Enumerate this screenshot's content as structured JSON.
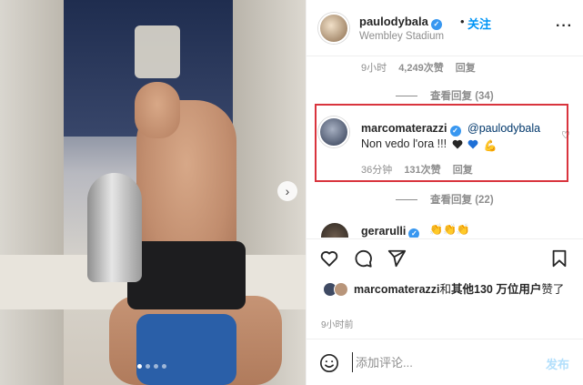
{
  "post": {
    "username": "paulodybala",
    "follow_label": "关注",
    "separator": "•",
    "location": "Wembley Stadium",
    "more_icon": "more-horizontal-icon"
  },
  "photo": {
    "description_icon": "post-photo",
    "next_icon": "chevron-right-icon",
    "carousel_dots": 4,
    "active_dot": 1
  },
  "previous_comment": {
    "time": "9小时",
    "likes": "4,249次赞",
    "reply_label": "回复"
  },
  "view_replies_1": "查看回复 (34)",
  "highlighted_comment": {
    "username": "marcomaterazzi",
    "mention": "@paulodybala",
    "text": "Non vedo l'ora !!!",
    "emoji": [
      "black-heart",
      "blue-heart",
      "flexed-biceps"
    ],
    "time": "36分钟",
    "likes": "131次赞",
    "reply_label": "回复",
    "highlight_color": "#d9343d"
  },
  "view_replies_2": "查看回复 (22)",
  "partial_comment": {
    "username": "gerarulli",
    "emoji": "👏👏👏"
  },
  "actions": {
    "like_icon": "heart-icon",
    "comment_icon": "comment-icon",
    "share_icon": "send-icon",
    "save_icon": "bookmark-icon"
  },
  "liked_by": {
    "user": "marcomaterazzi",
    "and": "和",
    "others": "其他130 万位用户",
    "suffix": "赞了"
  },
  "timestamp": "9小时前",
  "comment_box": {
    "placeholder": "添加评论...",
    "post_label": "发布",
    "emoji_icon": "smiley-icon"
  },
  "colors": {
    "accent": "#0095f6",
    "verified": "#3897f0",
    "muted": "#8e8e8e",
    "post_disabled": "#b2dffc"
  }
}
